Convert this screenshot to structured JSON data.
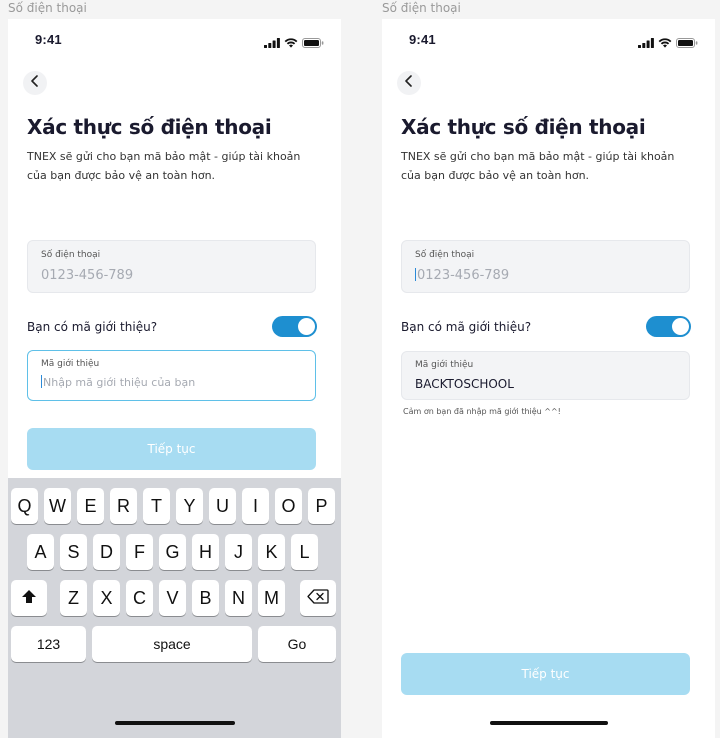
{
  "frames": [
    {
      "label": "Số điện thoại",
      "time": "9:41",
      "title": "Xác thực số điện thoại",
      "subtitle": "TNEX sẽ gửi cho bạn mã bảo mật - giúp tài khoản của bạn được bảo vệ an toàn hơn.",
      "phone_field": {
        "label": "Số điện thoại",
        "placeholder": "0123-456-789"
      },
      "referral_toggle": {
        "label": "Bạn có mã giới thiệu?",
        "on": true
      },
      "referral_field": {
        "label": "Mã giới thiệu",
        "placeholder": "Nhập mã giới thiệu của bạn",
        "value": ""
      },
      "continue_label": "Tiếp tục"
    },
    {
      "label": "Số điện thoại",
      "time": "9:41",
      "title": "Xác thực số điện thoại",
      "subtitle": "TNEX sẽ gửi cho bạn mã bảo mật - giúp tài khoản của bạn được bảo vệ an toàn hơn.",
      "phone_field": {
        "label": "Số điện thoại",
        "placeholder": "0123-456-789"
      },
      "referral_toggle": {
        "label": "Bạn có mã giới thiệu?",
        "on": true
      },
      "referral_field": {
        "label": "Mã giới thiệu",
        "value": "BACKTOSCHOOL"
      },
      "referral_hint": "Cảm ơn bạn đã nhập mã giới thiệu ^^!",
      "continue_label": "Tiếp tục"
    }
  ],
  "keyboard": {
    "row1": [
      "Q",
      "W",
      "E",
      "R",
      "T",
      "Y",
      "U",
      "I",
      "O",
      "P"
    ],
    "row2": [
      "A",
      "S",
      "D",
      "F",
      "G",
      "H",
      "J",
      "K",
      "L"
    ],
    "row3": [
      "Z",
      "X",
      "C",
      "V",
      "B",
      "N",
      "M"
    ],
    "numbers_label": "123",
    "space_label": "space",
    "go_label": "Go"
  },
  "colors": {
    "accent": "#1e8fd0",
    "focus_border": "#5fc0e8",
    "button_disabled": "#a7dcf2",
    "field_bg": "#f3f4f6"
  },
  "icons": [
    "signal-icon",
    "wifi-icon",
    "battery-icon",
    "back-chevron-icon",
    "shift-icon",
    "delete-icon"
  ]
}
